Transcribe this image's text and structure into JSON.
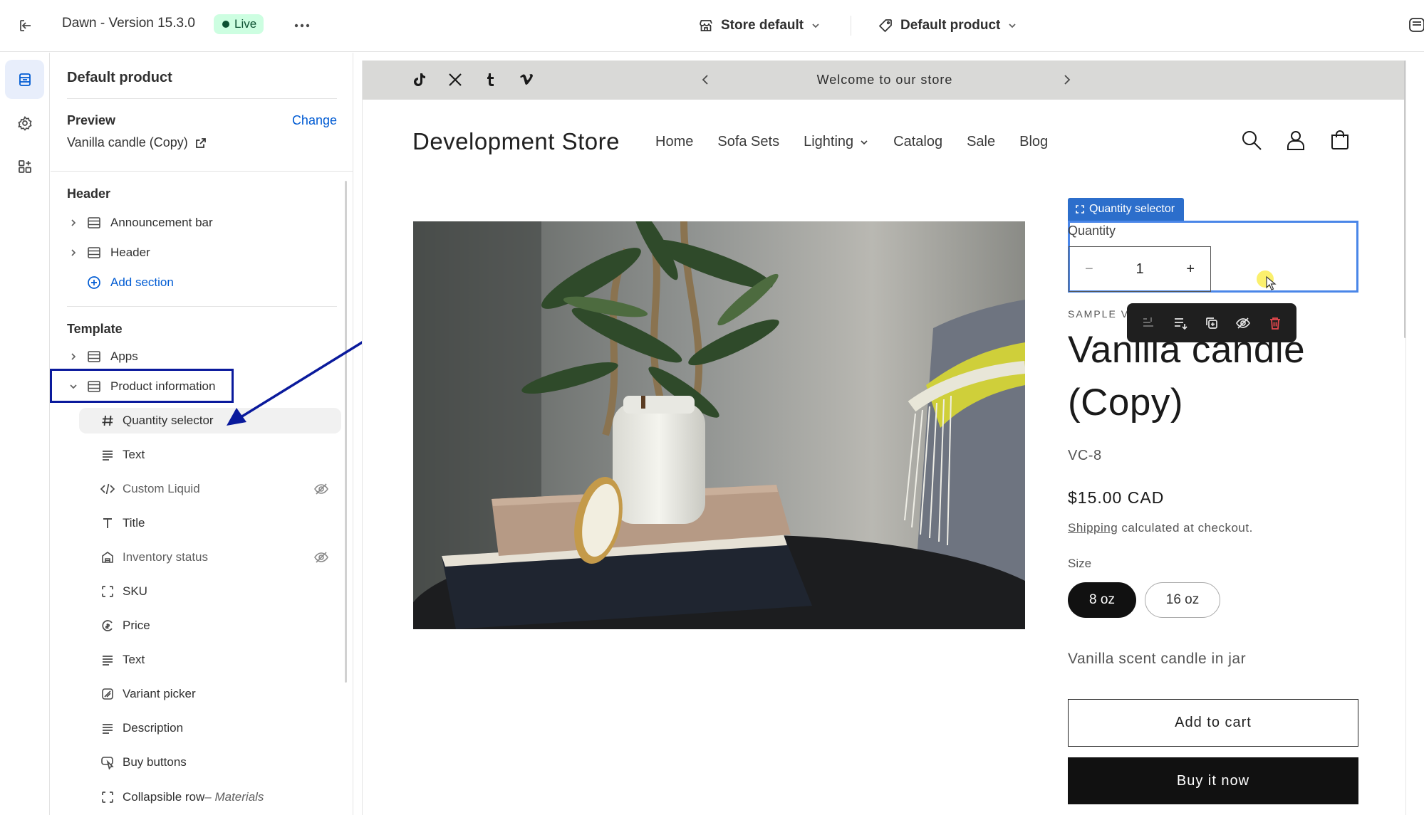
{
  "topbar": {
    "title": "Dawn - Version 15.3.0",
    "status": "Live",
    "store_select": "Store default",
    "product_select": "Default product"
  },
  "rail": {
    "icons": [
      "sections-icon",
      "settings-icon",
      "apps-icon"
    ]
  },
  "sidebar": {
    "heading": "Default product",
    "preview_label": "Preview",
    "change_label": "Change",
    "preview_value": "Vanilla candle (Copy)",
    "header_group": "Header",
    "header_items": [
      {
        "label": "Announcement bar"
      },
      {
        "label": "Header"
      }
    ],
    "add_section": "Add section",
    "template_group": "Template",
    "template_items": [
      {
        "label": "Apps"
      },
      {
        "label": "Product information"
      }
    ],
    "blocks": [
      {
        "label": "Quantity selector"
      },
      {
        "label": "Text"
      },
      {
        "label": "Custom Liquid"
      },
      {
        "label": "Title"
      },
      {
        "label": "Inventory status"
      },
      {
        "label": "SKU"
      },
      {
        "label": "Price"
      },
      {
        "label": "Text"
      },
      {
        "label": "Variant picker"
      },
      {
        "label": "Description"
      },
      {
        "label": "Buy buttons"
      },
      {
        "label": "Collapsible row",
        "suffix": " – Materials"
      }
    ]
  },
  "preview": {
    "announcement": "Welcome to our store",
    "store_name": "Development Store",
    "nav": [
      "Home",
      "Sofa Sets",
      "Lighting",
      "Catalog",
      "Sale",
      "Blog"
    ],
    "selected_block_tag": "Quantity selector",
    "quantity_label": "Quantity",
    "quantity_value": "1",
    "vendor": "SAMPLE VE",
    "product_title_line1": "Vanilla candle",
    "product_title_line2": "(Copy)",
    "sku": "VC-8",
    "price": "$15.00 CAD",
    "shipping_link": "Shipping",
    "shipping_text": " calculated at checkout.",
    "size_label": "Size",
    "sizes": [
      "8 oz",
      "16 oz"
    ],
    "selected_size": "8 oz",
    "description": "Vanilla scent candle in jar",
    "add_to_cart": "Add to cart",
    "buy_now": "Buy it now"
  },
  "colors": {
    "accent": "#005bd3",
    "live_bg": "#cdfee1",
    "selection_blue": "#2c6ecb",
    "annotation_navy": "#0a1a9c"
  }
}
